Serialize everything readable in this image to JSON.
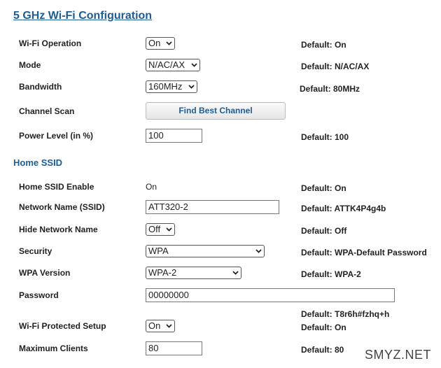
{
  "page_title": "5 GHz Wi-Fi Configuration",
  "sections": {
    "home_ssid": "Home SSID"
  },
  "rows": {
    "wifi_operation": {
      "label": "Wi-Fi Operation",
      "value": "On",
      "default": "Default: On"
    },
    "mode": {
      "label": "Mode",
      "value": "N/AC/AX",
      "default": "Default: N/AC/AX"
    },
    "bandwidth": {
      "label": "Bandwidth",
      "value": "160MHz",
      "default": "Default: 80MHz"
    },
    "channel_scan": {
      "label": "Channel Scan",
      "button": "Find Best Channel"
    },
    "power_level": {
      "label": "Power Level (in %)",
      "value": "100",
      "default": "Default: 100"
    },
    "home_ssid_enable": {
      "label": "Home SSID Enable",
      "value": "On",
      "default": "Default: On"
    },
    "network_name": {
      "label": "Network Name (SSID)",
      "value": "ATT320-2",
      "default": "Default: ATTK4P4g4b"
    },
    "hide_network_name": {
      "label": "Hide Network Name",
      "value": "Off",
      "default": "Default: Off"
    },
    "security": {
      "label": "Security",
      "value": "WPA",
      "default": "Default: WPA-Default Password"
    },
    "wpa_version": {
      "label": "WPA Version",
      "value": "WPA-2",
      "default": "Default: WPA-2"
    },
    "password": {
      "label": "Password",
      "value": "00000000",
      "default": "Default: T8r6h#fzhq+h"
    },
    "wps": {
      "label": "Wi-Fi Protected Setup",
      "value": "On",
      "default": "Default: On"
    },
    "max_clients": {
      "label": "Maximum Clients",
      "value": "80",
      "default": "Default: 80"
    }
  },
  "watermark": "SMYZ.NET",
  "icons": {
    "dropdown": "chevron-down-icon"
  }
}
